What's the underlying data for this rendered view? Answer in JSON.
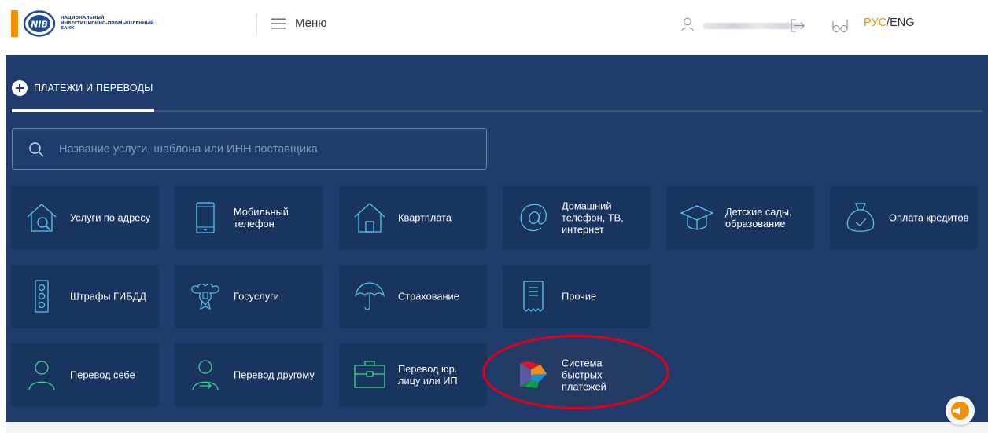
{
  "header": {
    "logo_text_line1": "НАЦИОНАЛЬНЫЙ",
    "logo_text_line2": "ИНВЕСТИЦИОННО-ПРОМЫШЛЕННЫЙ",
    "logo_text_line3": "БАНК",
    "logo_emblem_text": "NIB",
    "menu_label": "Меню",
    "lang_active": "РУС",
    "lang_separator": "/",
    "lang_inactive": "ENG"
  },
  "colors": {
    "brand_orange": "#f39200",
    "panel_bg": "#1f3c6d",
    "tile_bg": "#19345f",
    "icon_blue": "#58c2f0",
    "icon_green": "#3fd389",
    "highlight_red": "#e1001a"
  },
  "section": {
    "title": "ПЛАТЕЖИ И ПЕРЕВОДЫ"
  },
  "search": {
    "placeholder": "Название услуги, шаблона или ИНН поставщика"
  },
  "tiles": [
    {
      "label": "Услуги по адресу",
      "icon": "house-search-icon"
    },
    {
      "label": "Мобильный телефон",
      "icon": "mobile-phone-icon"
    },
    {
      "label": "Квартплата",
      "icon": "house-icon"
    },
    {
      "label": "Домашний телефон, ТВ, интернет",
      "icon": "at-sign-icon"
    },
    {
      "label": "Детские сады, образование",
      "icon": "graduation-cap-icon"
    },
    {
      "label": "Оплата кредитов",
      "icon": "money-bag-icon"
    },
    {
      "label": "Штрафы ГИБДД",
      "icon": "traffic-light-icon"
    },
    {
      "label": "Госуслуги",
      "icon": "state-emblem-icon"
    },
    {
      "label": "Страхование",
      "icon": "umbrella-icon"
    },
    {
      "label": "Прочие",
      "icon": "receipt-icon"
    },
    {
      "label": "Перевод себе",
      "icon": "user-self-icon"
    },
    {
      "label": "Перевод другому",
      "icon": "user-transfer-icon"
    },
    {
      "label": "Перевод юр. лицу или ИП",
      "icon": "briefcase-icon"
    },
    {
      "label": "Система быстрых платежей",
      "icon": "sbp-logo-icon"
    }
  ]
}
